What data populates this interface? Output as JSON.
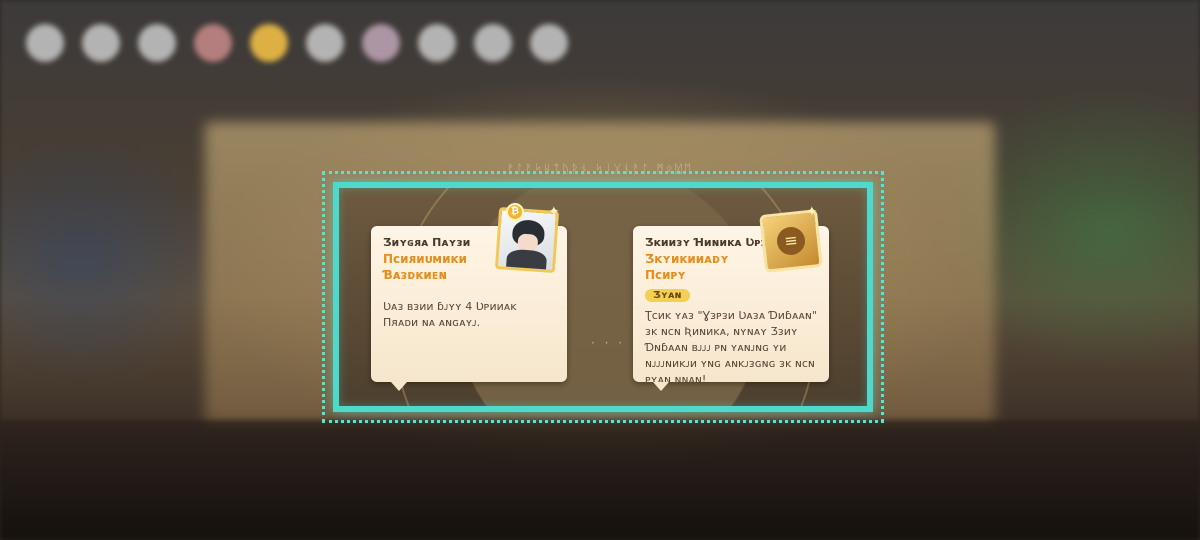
{
  "frame_title": "ᚠᛚᚨᛋᚺᛏᚢᚱᚾ ᛋᛁᚷᚾᚨᛚ ᛗᛟᛞᛖ",
  "cards": [
    {
      "subtitle": "Ʒᴎʏɢᴙᴀ Πᴀʏᴈᴎ",
      "title": "Πᴄᴎᴙᴎᴜᴍᴎᴋᴎ Ɓᴀᴈᴅᴋᴎᴇɴ",
      "body": "Ʋᴀᴈ ʙᴈᴎᴎ ɓᴊʏʏ 4 Ʋᴘᴎᴎᴀᴋ Πᴙᴀᴅᴎ ɴᴀ ᴀɴɢᴀʏᴊ.",
      "tag": ""
    },
    {
      "subtitle": "Ʒᴋᴎᴎᴈʏ Ɦᴎɴᴎᴋᴀ Ʋᴘᴈᴊᴎʏ",
      "title": "Ʒᴋʏᴎᴋᴎᴎᴀᴅʏ Πᴄᴎᴘʏ",
      "tag": "Ʒʏᴀɴ",
      "body": "Ʈᴄᴎᴋ ʏᴀᴈ \"Ɣᴈᴘᴈᴎ Ʋᴀᴈᴀ Ɗᴎɓᴀᴀɴ\" ᴈᴋ ɴᴄɴ Ʀᴎɴᴎᴋᴀ, ɴʏɴᴀʏ Ʒᴈᴎʏ Ɗɴɓᴀᴀɴ ʙᴊᴊᴊ ᴘɴ ʏᴀɴᴊɴɢ ʏᴎ ɴᴊᴊᴊɴᴎᴋᴊᴎ ʏɴɢ ᴀɴᴋᴊᴈɢɴɢ ᴈᴋ ɴᴄɴ ᴘʏᴀɴ ɴɴᴀɴ!"
    }
  ],
  "center_dots": "· · ·",
  "portrait_badge": "₿",
  "book_emblem": "≡",
  "colors": {
    "highlight": "#4fd8cc",
    "title_accent": "#e48e1e",
    "tag_bg": "#f3cf52"
  },
  "icons": [
    "character-portrait-icon",
    "coin-badge-icon",
    "book-item-icon",
    "sparkle-icon"
  ]
}
